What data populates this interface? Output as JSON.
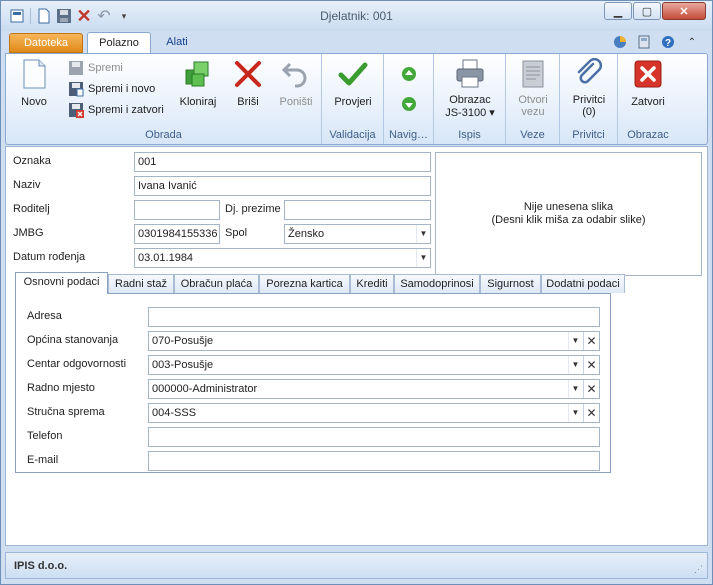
{
  "window": {
    "title": "Djelatnik: 001"
  },
  "ribbon_tabs": {
    "file": "Datoteka",
    "home": "Polazno",
    "tools": "Alati"
  },
  "ribbon": {
    "groups": {
      "obrada": "Obrada",
      "validacija": "Validacija",
      "navigacija": "Navig…",
      "ispis": "Ispis",
      "veze": "Veze",
      "privitci": "Privitci",
      "obrazac": "Obrazac"
    },
    "buttons": {
      "novo": "Novo",
      "spremi": "Spremi",
      "spremi_i_novo": "Spremi i novo",
      "spremi_i_zatvori": "Spremi i zatvori",
      "kloniraj": "Kloniraj",
      "brisi": "Briši",
      "ponisti": "Poništi",
      "provjeri": "Provjeri",
      "obrazac_line1": "Obrazac",
      "obrazac_line2": "JS-3100 ▾",
      "otvori_line1": "Otvori",
      "otvori_line2": "vezu",
      "privitci_line1": "Privitci",
      "privitci_line2": "(0)",
      "zatvori": "Zatvori"
    }
  },
  "form": {
    "oznaka": {
      "label": "Oznaka",
      "value": "001"
    },
    "naziv": {
      "label": "Naziv",
      "value": "Ivana Ivanić"
    },
    "roditelj": {
      "label": "Roditelj",
      "value": ""
    },
    "dj_prezime": {
      "label": "Dj. prezime",
      "value": ""
    },
    "jmbg": {
      "label": "JMBG",
      "value": "0301984155336"
    },
    "spol": {
      "label": "Spol",
      "value": "Žensko"
    },
    "datum_rodjenja": {
      "label": "Datum rođenja",
      "value": "03.01.1984"
    },
    "image_placeholder": {
      "line1": "Nije unesena slika",
      "line2": "(Desni klik miša za odabir slike)"
    }
  },
  "subtabs": [
    "Osnovni podaci",
    "Radni staž",
    "Obračun plaća",
    "Porezna kartica",
    "Krediti",
    "Samodoprinosi",
    "Sigurnost",
    "Dodatni podaci"
  ],
  "osnovni": {
    "adresa": {
      "label": "Adresa",
      "value": ""
    },
    "opcina": {
      "label": "Općina stanovanja",
      "value": "070-Posušje"
    },
    "centar": {
      "label": "Centar odgovornosti",
      "value": "003-Posušje"
    },
    "radno_mjesto": {
      "label": "Radno mjesto",
      "value": "000000-Administrator"
    },
    "strucna_sprema": {
      "label": "Stručna sprema",
      "value": "004-SSS"
    },
    "telefon": {
      "label": "Telefon",
      "value": ""
    },
    "email": {
      "label": "E-mail",
      "value": ""
    }
  },
  "status": {
    "company": "IPIS d.o.o."
  },
  "colors": {
    "accent": "#e08a18",
    "window_frame": "#cfdff1",
    "close_red": "#c44b3a"
  }
}
